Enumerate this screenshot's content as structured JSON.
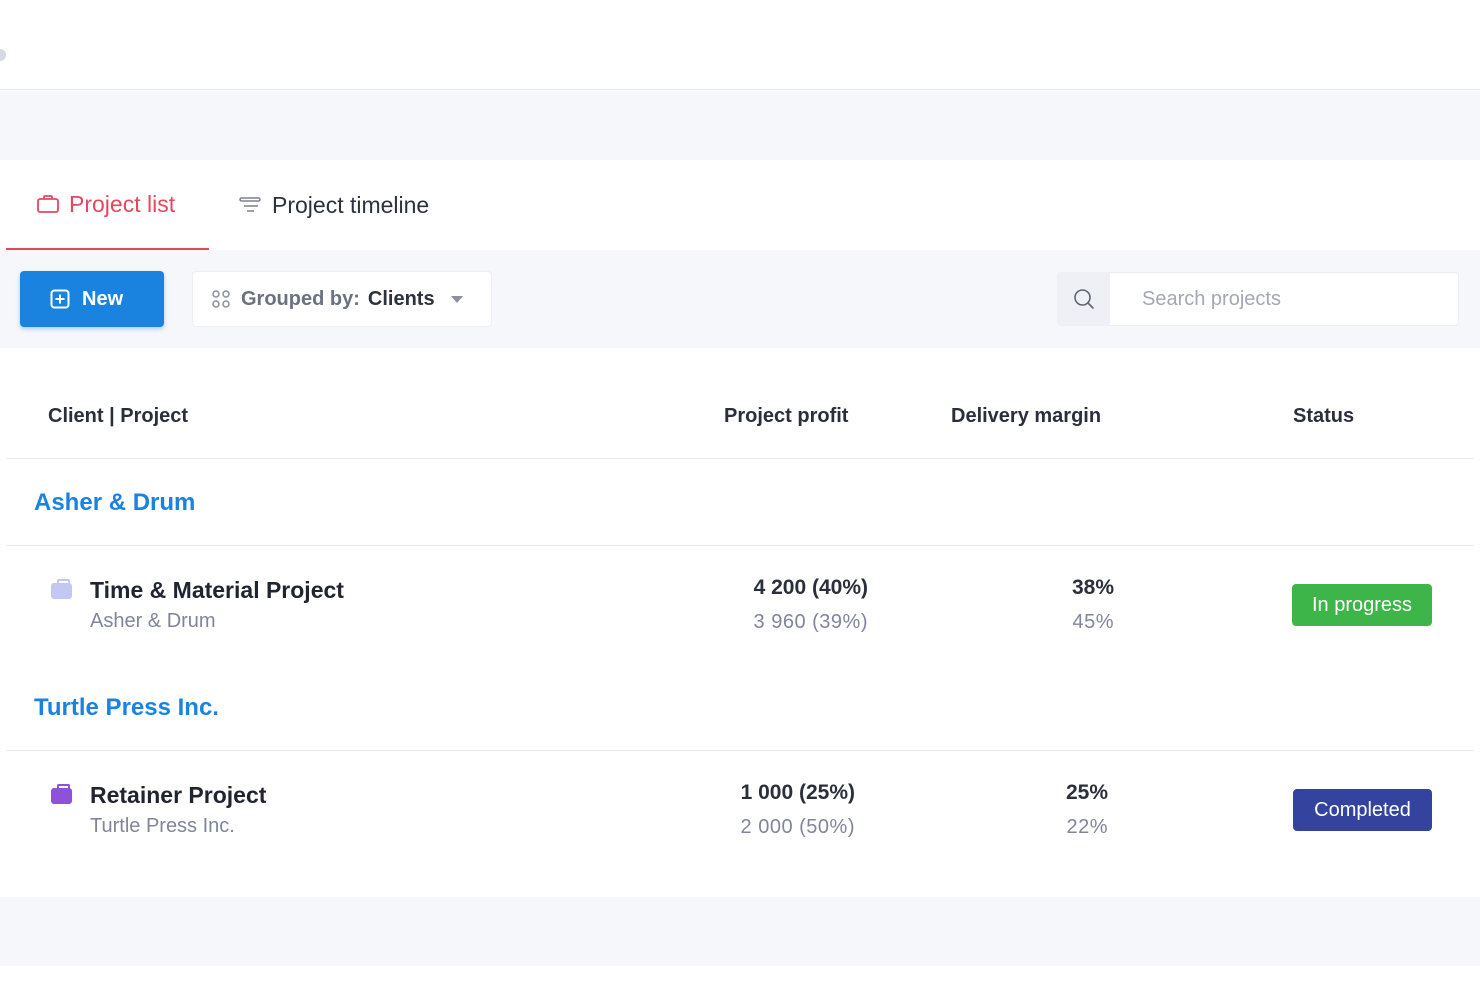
{
  "tabs": [
    {
      "label": "Project list",
      "icon": "briefcase-icon",
      "active": true
    },
    {
      "label": "Project timeline",
      "icon": "timeline-icon",
      "active": false
    }
  ],
  "toolbar": {
    "new_label": "New",
    "group_label": "Grouped by:",
    "group_value": "Clients",
    "search_placeholder": "Search projects"
  },
  "table": {
    "headers": {
      "client_project": "Client | Project",
      "profit": "Project profit",
      "margin": "Delivery margin",
      "status": "Status"
    },
    "groups": [
      {
        "client": "Asher & Drum",
        "projects": [
          {
            "name": "Time & Material Project",
            "client": "Asher & Drum",
            "profit_main": "4 200 (40%)",
            "profit_sub": "3 960 (39%)",
            "margin_main": "38%",
            "margin_sub": "45%",
            "status": "In progress",
            "status_color": "#3db548",
            "icon_color": "#c4c6f3"
          }
        ]
      },
      {
        "client": "Turtle Press Inc.",
        "projects": [
          {
            "name": "Retainer Project",
            "client": "Turtle Press Inc.",
            "profit_main": "1 000 (25%)",
            "profit_sub": "2 000 (50%)",
            "margin_main": "25%",
            "margin_sub": "22%",
            "status": "Completed",
            "status_color": "#34449e",
            "icon_color": "#8e52d8"
          }
        ]
      }
    ]
  },
  "colors": {
    "accent": "#1a83e0",
    "active_tab": "#e5475f"
  }
}
